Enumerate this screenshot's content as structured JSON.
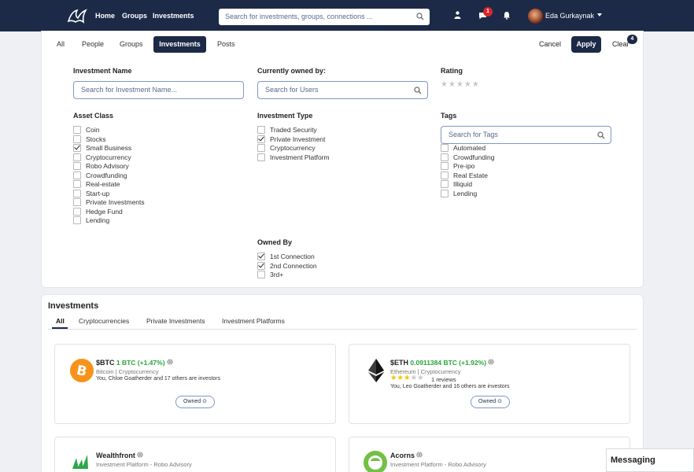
{
  "nav": {
    "links": [
      "Home",
      "Groups",
      "Investments"
    ],
    "search_placeholder": "Search for investments, groups, connections ...",
    "message_count": "1",
    "user_name": "Eda Gurkaynak"
  },
  "filter_tabs": [
    "All",
    "People",
    "Groups",
    "Investments",
    "Posts"
  ],
  "actions": {
    "cancel": "Cancel",
    "apply": "Apply",
    "clear": "Clear",
    "clear_count": "4"
  },
  "filters": {
    "investment_name": {
      "label": "Investment Name",
      "placeholder": "Search for Investment Name..."
    },
    "owned_by_users": {
      "label": "Currently owned by:",
      "placeholder": "Search for Users"
    },
    "rating": {
      "label": "Rating",
      "stars": "★★★★★"
    },
    "asset_class": {
      "label": "Asset Class",
      "options": [
        {
          "label": "Coin",
          "checked": false
        },
        {
          "label": "Stocks",
          "checked": false
        },
        {
          "label": "Small Business",
          "checked": true
        },
        {
          "label": "Cryptocurrency",
          "checked": false
        },
        {
          "label": "Robo Advisory",
          "checked": false
        },
        {
          "label": "Crowdfunding",
          "checked": false
        },
        {
          "label": "Real-estate",
          "checked": false
        },
        {
          "label": "Start-up",
          "checked": false
        },
        {
          "label": "Private Investments",
          "checked": false
        },
        {
          "label": "Hedge Fund",
          "checked": false
        },
        {
          "label": "Lending",
          "checked": false
        }
      ]
    },
    "investment_type": {
      "label": "Investment Type",
      "options": [
        {
          "label": "Traded Security",
          "checked": false
        },
        {
          "label": "Private Investment",
          "checked": true
        },
        {
          "label": "Cryptocurrency",
          "checked": false
        },
        {
          "label": "Investment Platform",
          "checked": false
        }
      ]
    },
    "tags": {
      "label": "Tags",
      "placeholder": "Search for Tags",
      "options": [
        {
          "label": "Automated",
          "checked": false
        },
        {
          "label": "Crowdfunding",
          "checked": false
        },
        {
          "label": "Pre-ipo",
          "checked": false
        },
        {
          "label": "Real Estate",
          "checked": false
        },
        {
          "label": "Illiquid",
          "checked": false
        },
        {
          "label": "Lending",
          "checked": false
        }
      ]
    },
    "owned_by": {
      "label": "Owned By",
      "options": [
        {
          "label": "1st Connection",
          "checked": true
        },
        {
          "label": "2nd Connection",
          "checked": true
        },
        {
          "label": "3rd+",
          "checked": false
        }
      ]
    }
  },
  "investments": {
    "title": "Investments",
    "tabs": [
      "All",
      "Cryptocurrencies",
      "Private Investments",
      "Investment Platforms"
    ],
    "cards": [
      {
        "name": "$BTC",
        "price": "1 BTC (+1.47%)",
        "category": "Bitcoin | Cryptocurrency",
        "investors": "You, Chloe Goatherder and 17 others are investors",
        "owned": "Owned",
        "icon": "bitcoin-icon"
      },
      {
        "name": "$ETH",
        "price": "0.0911384 BTC (+1.92%)",
        "category": "Ethereum | Cryptocurrency",
        "reviews": "1 reviews",
        "rating": 3,
        "investors": "You, Leo Goatherder and 16 others are investors",
        "owned": "Owned",
        "icon": "ethereum-icon"
      },
      {
        "name": "Wealthfront",
        "category": "Investment Platform - Robo Advisory",
        "icon": "wealthfront-logo"
      },
      {
        "name": "Acorns",
        "category": "Investment Platform - Robo Advisory",
        "icon": "acorns-logo"
      }
    ]
  },
  "messaging": "Messaging"
}
